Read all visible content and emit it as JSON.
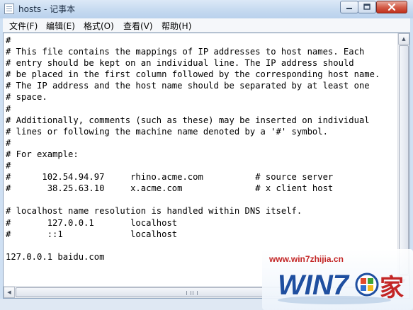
{
  "window": {
    "title": "hosts - 记事本",
    "controls": {
      "minimize_icon": "minimize-icon",
      "maximize_icon": "maximize-icon",
      "close_icon": "close-icon",
      "close_color": "#c7321f"
    }
  },
  "menu": {
    "items": [
      {
        "label": "文件(F)"
      },
      {
        "label": "编辑(E)"
      },
      {
        "label": "格式(O)"
      },
      {
        "label": "查看(V)"
      },
      {
        "label": "帮助(H)"
      }
    ]
  },
  "editor": {
    "lines": [
      "#",
      "# This file contains the mappings of IP addresses to host names. Each",
      "# entry should be kept on an individual line. The IP address should",
      "# be placed in the first column followed by the corresponding host name.",
      "# The IP address and the host name should be separated by at least one",
      "# space.",
      "#",
      "# Additionally, comments (such as these) may be inserted on individual",
      "# lines or following the machine name denoted by a '#' symbol.",
      "#",
      "# For example:",
      "#",
      "#      102.54.94.97     rhino.acme.com          # source server",
      "#       38.25.63.10     x.acme.com              # x client host",
      "",
      "# localhost name resolution is handled within DNS itself.",
      "#       127.0.0.1       localhost",
      "#       ::1             localhost",
      "",
      "127.0.0.1 baidu.com"
    ]
  },
  "watermark": {
    "url": "www.win7zhijia.cn",
    "logo_text": "WIN7",
    "logo_char": "家",
    "brand_color": "#1f4fa0",
    "accent_color": "#c32525"
  }
}
